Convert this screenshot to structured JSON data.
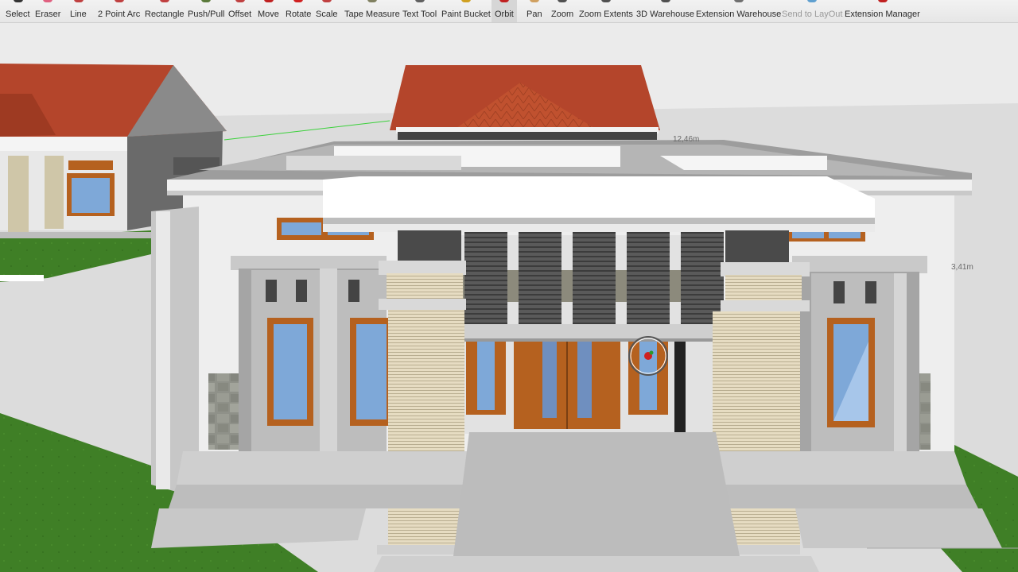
{
  "toolbar": {
    "tools": [
      {
        "label": "Select",
        "icon": "select-arrow-icon",
        "color": "#333333"
      },
      {
        "label": "Eraser",
        "icon": "eraser-icon",
        "color": "#e06080"
      },
      {
        "label": "Line",
        "icon": "pencil-icon",
        "color": "#c04040"
      },
      {
        "label": "2 Point Arc",
        "icon": "arc-icon",
        "color": "#c04040"
      },
      {
        "label": "Rectangle",
        "icon": "rectangle-icon",
        "color": "#c04040"
      },
      {
        "label": "Push/Pull",
        "icon": "push-pull-icon",
        "color": "#5a7a3a"
      },
      {
        "label": "Offset",
        "icon": "offset-icon",
        "color": "#c04040"
      },
      {
        "label": "Move",
        "icon": "move-icon",
        "color": "#c02020"
      },
      {
        "label": "Rotate",
        "icon": "rotate-icon",
        "color": "#d02020"
      },
      {
        "label": "Scale",
        "icon": "scale-icon",
        "color": "#c04040"
      },
      {
        "label": "Tape Measure",
        "icon": "tape-measure-icon",
        "color": "#808060"
      },
      {
        "label": "Text Tool",
        "icon": "text-icon",
        "color": "#606060"
      },
      {
        "label": "Paint Bucket",
        "icon": "paint-bucket-icon",
        "color": "#d0a020"
      },
      {
        "label": "Orbit",
        "icon": "orbit-icon",
        "color": "#c02020"
      },
      {
        "label": "Pan",
        "icon": "pan-hand-icon",
        "color": "#d0a060"
      },
      {
        "label": "Zoom",
        "icon": "zoom-icon",
        "color": "#505050"
      },
      {
        "label": "Zoom Extents",
        "icon": "zoom-extents-icon",
        "color": "#505050"
      },
      {
        "label": "3D Warehouse",
        "icon": "3d-warehouse-icon",
        "color": "#505050"
      },
      {
        "label": "Extension Warehouse",
        "icon": "extension-warehouse-icon",
        "color": "#707070"
      },
      {
        "label": "Send to LayOut",
        "icon": "send-to-layout-icon",
        "color": "#60a0d0"
      },
      {
        "label": "Extension Manager",
        "icon": "extension-manager-icon",
        "color": "#c02020"
      }
    ],
    "active_tool": "Orbit",
    "disabled_tool": "Send to LayOut"
  },
  "viewport": {
    "dimension_label_right": "3,41m",
    "dimension_label_top": "12,46m",
    "colors": {
      "sky": "#ebebeb",
      "grass": "#3f7f26",
      "roof": "#b4452b",
      "wall": "#efefef",
      "wood": "#b5611f",
      "glass": "#7ea8d8",
      "stone": "#8e8f88"
    }
  }
}
